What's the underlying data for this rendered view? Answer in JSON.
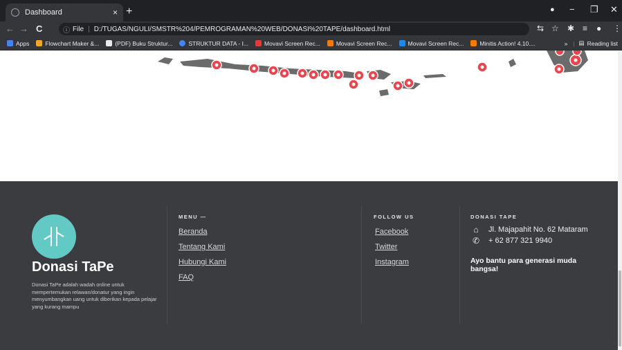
{
  "browser": {
    "tab_title": "Dashboard",
    "tab_close": "×",
    "new_tab": "+",
    "win_min": "−",
    "win_max": "❐",
    "win_close": "✕",
    "nav_back": "←",
    "nav_forward": "→",
    "nav_reload": "C",
    "address_label": "File",
    "address_url": "D:/TUGAS/NGULI/SMSTR%204/PEMROGRAMAN%20WEB/DONASI%20TAPE/dashboard.html",
    "bookmarks": [
      {
        "label": "Apps",
        "color": "#4285f4"
      },
      {
        "label": "Flowchart Maker &...",
        "color": "#f6a623"
      },
      {
        "label": "(PDF) Buku Struktur...",
        "color": "#e8eaed"
      },
      {
        "label": "STRUKTUR DATA - I...",
        "color": "#4285f4"
      },
      {
        "label": "Movavi Screen Rec...",
        "color": "#e53935"
      },
      {
        "label": "Movavi Screen Rec...",
        "color": "#f57c00"
      },
      {
        "label": "Movavi Screen Rec...",
        "color": "#1e88e5"
      },
      {
        "label": "Minitis Action! 4.10....",
        "color": "#f57c00"
      }
    ],
    "more_bookmarks": "»",
    "reading_list": "Reading list"
  },
  "footer": {
    "brand": "Donasi TaPe",
    "about": "Donasi TaPe adalah wadah online untuk mempertemukan relawan/donatur yang ingin menyumbangkan uang untuk diberikan kepada pelajar yang kurang mampu",
    "menu_heading": "MENU —",
    "menu": [
      "Beranda",
      "Tentang Kami",
      "Hubungi Kami",
      "FAQ"
    ],
    "follow_heading": "FOLLOW US",
    "follow": [
      "Facebook",
      "Twitter",
      "Instagram"
    ],
    "contact_heading": "DONASI TAPE",
    "address": "Jl. Majapahit No. 62 Mataram",
    "phone": "+ 62 877 321 9940",
    "cta": "Ayo bantu para generasi muda bangsa!",
    "accent": "#63c9c4"
  }
}
